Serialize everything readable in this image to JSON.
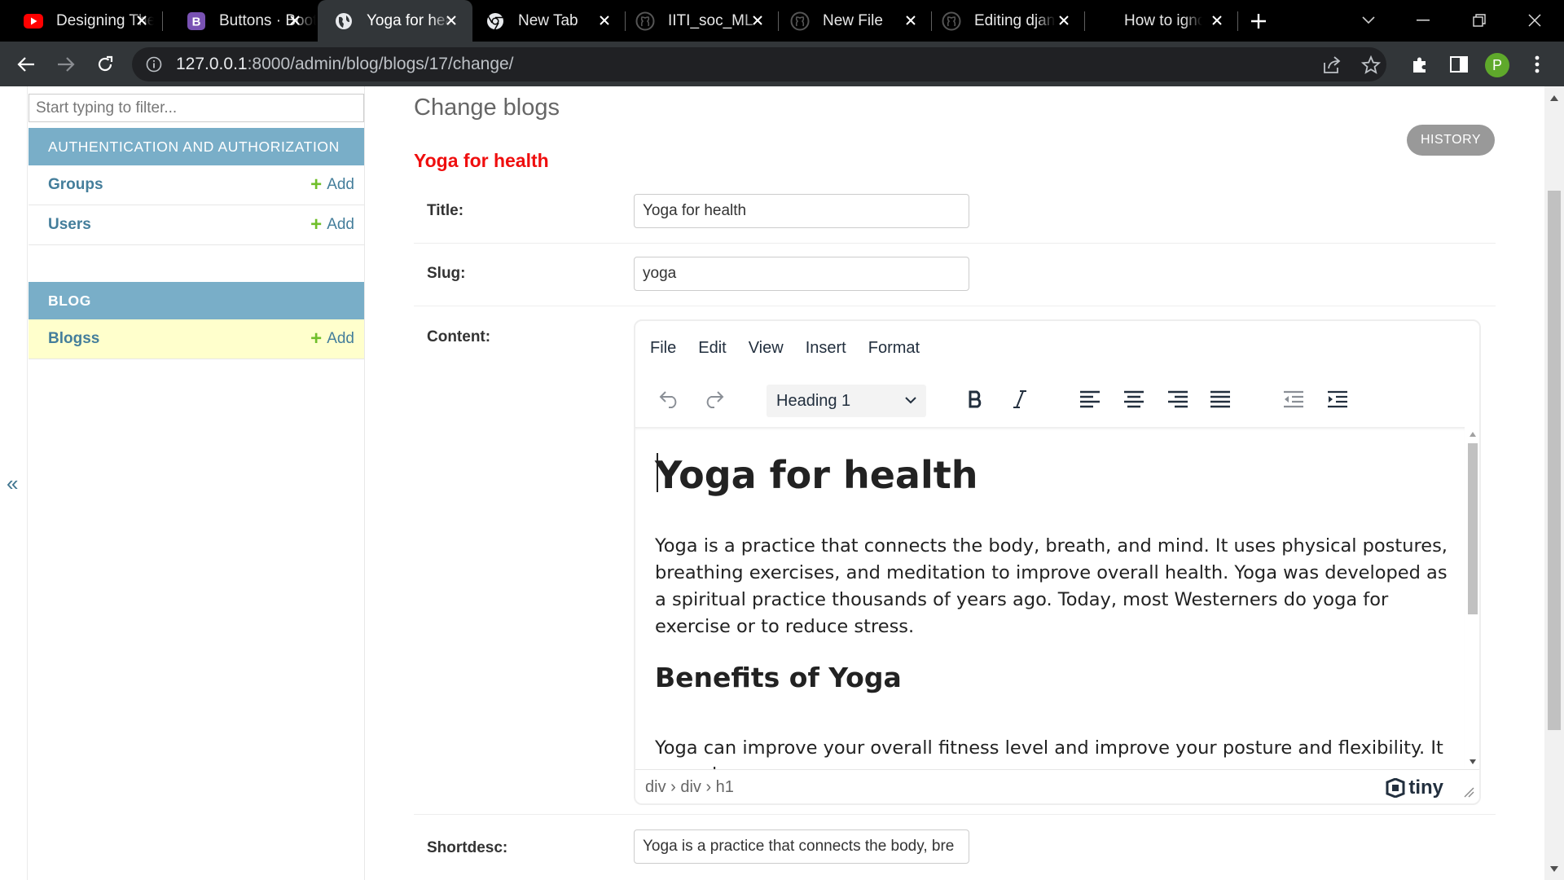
{
  "browser": {
    "tabs": [
      {
        "title": "Designing The",
        "icon": "youtube-icon"
      },
      {
        "title": "Buttons · Bootstrap",
        "icon": "bootstrap-icon"
      },
      {
        "title": "Yoga for health",
        "icon": "globe-icon",
        "active": true
      },
      {
        "title": "New Tab",
        "icon": "chrome-icon"
      },
      {
        "title": "IITI_soc_ML",
        "icon": "github-icon"
      },
      {
        "title": "New File",
        "icon": "github-icon"
      },
      {
        "title": "Editing django",
        "icon": "github-icon"
      },
      {
        "title": "How to ignore",
        "icon": "none"
      }
    ],
    "url_host": "127.0.0.1",
    "url_path": ":8000/admin/blog/blogs/17/change/",
    "profile_initial": "P"
  },
  "sidebar": {
    "filter_placeholder": "Start typing to filter...",
    "collapse_glyph": "«",
    "modules": [
      {
        "caption": "AUTHENTICATION AND AUTHORIZATION",
        "models": [
          {
            "name": "Groups",
            "add": "Add"
          },
          {
            "name": "Users",
            "add": "Add"
          }
        ]
      },
      {
        "caption": "BLOG",
        "models": [
          {
            "name": "Blogss",
            "add": "Add",
            "current": true
          }
        ]
      }
    ]
  },
  "main": {
    "heading": "Change blogs",
    "history_label": "HISTORY",
    "object_title": "Yoga for health",
    "fields": {
      "title": {
        "label": "Title:",
        "value": "Yoga for health"
      },
      "slug": {
        "label": "Slug:",
        "value": "yoga"
      },
      "content": {
        "label": "Content:"
      },
      "shortdesc": {
        "label": "Shortdesc:",
        "value": "Yoga is a practice that connects the body, bre"
      }
    }
  },
  "editor": {
    "menus": [
      "File",
      "Edit",
      "View",
      "Insert",
      "Format"
    ],
    "block_format": "Heading 1",
    "h1": "Yoga for health",
    "p1": "Yoga is a practice that connects the body, breath, and mind. It uses physical postures, breathing exercises, and meditation to improve overall health. Yoga was developed as a spiritual practice thousands of years ago. Today, most Westerners do yoga for exercise or to reduce stress.",
    "h2": "Benefits of Yoga",
    "p2": "Yoga can improve your overall fitness level and improve your posture and flexibility. It may also:",
    "path": "div › div › h1",
    "brand": "tiny"
  },
  "colors": {
    "module_header": "#79aec8",
    "link": "#447e9b",
    "add_plus": "#70bf2b",
    "current_row": "#ffffcc",
    "object_title": "#ef0e0e",
    "history_button": "#999999"
  }
}
